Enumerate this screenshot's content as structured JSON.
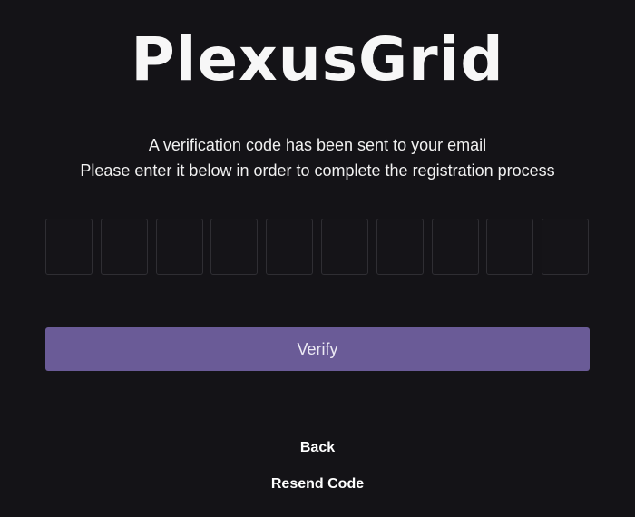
{
  "brand": {
    "name": "PlexusGrid"
  },
  "message": {
    "line1": "A verification code has been sent to your email",
    "line2": "Please enter it below in order to complete the registration process"
  },
  "code_inputs": {
    "count": 10,
    "values": [
      "",
      "",
      "",
      "",
      "",
      "",
      "",
      "",
      "",
      ""
    ]
  },
  "actions": {
    "verify_label": "Verify",
    "back_label": "Back",
    "resend_label": "Resend Code"
  },
  "colors": {
    "background": "#141317",
    "accent": "#6a5b97",
    "input_border": "#2f2e33",
    "text": "#ffffff"
  }
}
